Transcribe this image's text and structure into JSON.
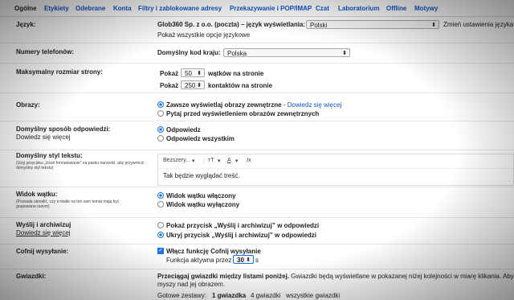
{
  "tabs": [
    {
      "label": "Ogólne"
    },
    {
      "label": "Etykiety"
    },
    {
      "label": "Odebrane"
    },
    {
      "label": "Konta"
    },
    {
      "label": "Filtry i zablokowane adresy"
    },
    {
      "label": "Przekazywanie i POP/IMAP"
    },
    {
      "label": "Czat"
    },
    {
      "label": "Laboratorium"
    },
    {
      "label": "Offline"
    },
    {
      "label": "Motywy"
    }
  ],
  "language": {
    "label": "Język:",
    "text": "Glob360 Sp. z o.o. (poczta) – język wyświetlania:",
    "value": "Polski",
    "change_link": "Zmień ustawienia języka",
    "all_options_link": "Pokaż wszystkie opcje językowe"
  },
  "phone": {
    "label": "Numery telefonów:",
    "text": "Domyślny kod kraju:",
    "value": "Polska"
  },
  "page_size": {
    "label": "Maksymalny rozmiar strony:",
    "show1": "Pokaż",
    "threads_value": "50",
    "threads_suffix": "wątków na stronie",
    "show2": "Pokaż",
    "contacts_value": "250",
    "contacts_suffix": "kontaktów na stronie"
  },
  "images": {
    "label": "Obrazy:",
    "opt1": "Zawsze wyświetlaj obrazy zewnętrzne",
    "opt1_sep": " - ",
    "opt1_link": "Dowiedz się więcej",
    "opt2": "Pytaj przed wyświetleniem obrazów zewnętrznych"
  },
  "reply": {
    "label": "Domyślny sposób odpowiedzi:",
    "learn_more": "Dowiedz się więcej",
    "opt1": "Odpowiedz",
    "opt2": "Odpowiedz wszystkim"
  },
  "text_style": {
    "label": "Domyślny styl tekstu:",
    "description": "(Użyj przycisku „Usuń formatowanie” na pasku narzędzi, aby przywrócić domyślny styl tekstu)",
    "font_name": "Bezszery...",
    "size_icon": "size-icon",
    "color_icon": "text-color-icon",
    "clear_icon": "clear-formatting-icon",
    "size_glyph": "тT",
    "color_glyph": "A",
    "clear_glyph": "Ix",
    "preview": "Tak będzie wyglądać treść."
  },
  "thread_view": {
    "label": "Widok wątku:",
    "description": "(Pozwala określić, czy e-maile na ten sam temat mają być grupowane razem)",
    "opt1": "Widok wątku włączony",
    "opt2": "Widok wątku wyłączony"
  },
  "send_archive": {
    "label": "Wyślij i archiwizuj",
    "learn_more": "Dowiedz się więcej",
    "opt1": "Pokaż przycisk „Wyślij i archiwizuj” w odpowiedzi",
    "opt2": "Ukryj przycisk „Wyślij i archiwizuj” w odpowiedzi"
  },
  "undo_send": {
    "label": "Cofnij wysyłanie:",
    "checkbox": "Włącz funkcję Cofnij wysyłanie",
    "period_text": "Funkcja aktywna przez",
    "seconds": "30",
    "unit": "s"
  },
  "stars": {
    "label": "Gwiazdki:",
    "text_bold": "Przeciągaj gwiazdki między listami poniżej.",
    "text_rest": "Gwiazdki będą wyświetlane w pokazanej niżej kolejności w miarę klikania. Aby p",
    "text_line2": "myszy nad jej obrazem.",
    "presets_label": "Gotowe zestawy:",
    "preset1": "1 gwiazdka",
    "preset2": "4 gwiazdki",
    "preset3": "wszystkie gwiazdki"
  }
}
